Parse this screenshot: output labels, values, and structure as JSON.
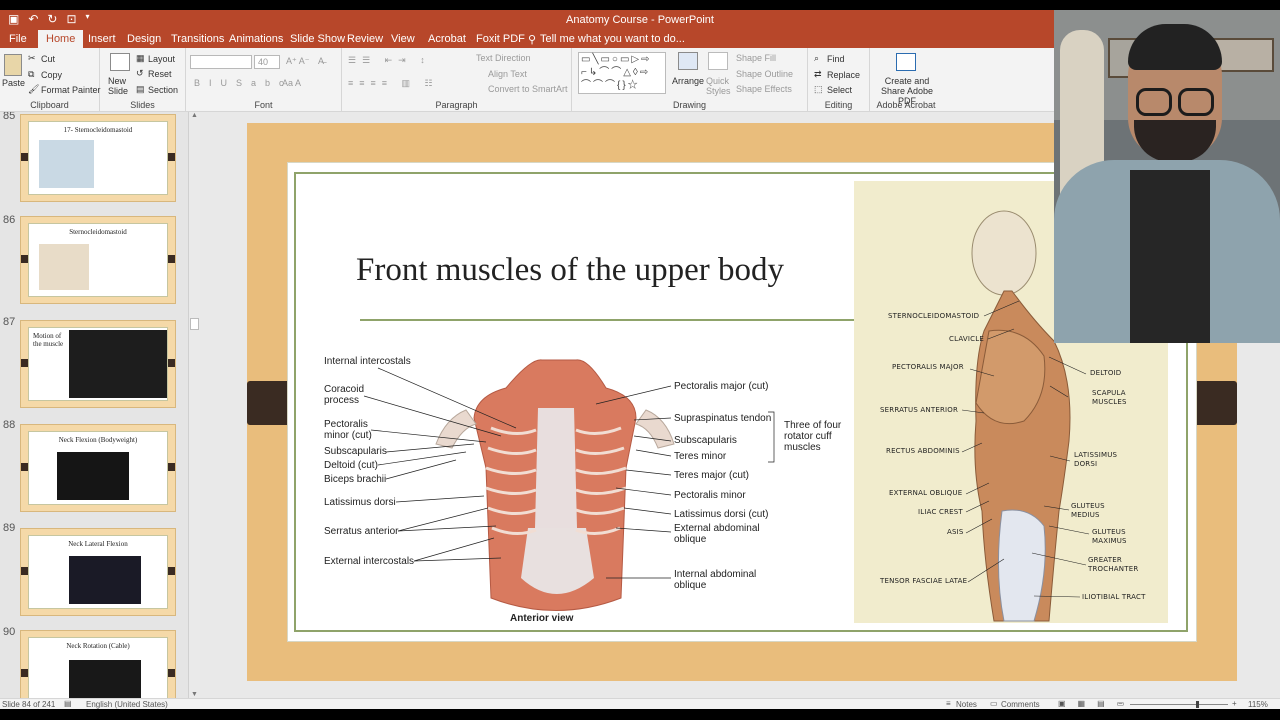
{
  "app": {
    "title": "Anatomy Course - PowerPoint"
  },
  "tabs": [
    "File",
    "Home",
    "Insert",
    "Design",
    "Transitions",
    "Animations",
    "Slide Show",
    "Review",
    "View",
    "Acrobat",
    "Foxit PDF"
  ],
  "tell_me": "Tell me what you want to do...",
  "ribbon": {
    "clipboard": {
      "label": "Clipboard",
      "paste": "Paste",
      "cut": "Cut",
      "copy": "Copy",
      "format_painter": "Format Painter"
    },
    "slides": {
      "label": "Slides",
      "new_slide": "New Slide",
      "layout": "Layout",
      "reset": "Reset",
      "section": "Section"
    },
    "font": {
      "label": "Font",
      "size": "40"
    },
    "paragraph": {
      "label": "Paragraph",
      "text_direction": "Text Direction",
      "align_text": "Align Text",
      "convert": "Convert to SmartArt"
    },
    "drawing": {
      "label": "Drawing",
      "arrange": "Arrange",
      "quick_styles": "Quick Styles",
      "shape_fill": "Shape Fill",
      "shape_outline": "Shape Outline",
      "shape_effects": "Shape Effects"
    },
    "editing": {
      "label": "Editing",
      "find": "Find",
      "replace": "Replace",
      "select": "Select"
    },
    "adobe": {
      "label": "Adobe Acrobat",
      "create_share": "Create and Share Adobe PDF"
    }
  },
  "thumbnails": [
    {
      "num": "85",
      "title": "17- Sternocleidomastoid"
    },
    {
      "num": "86",
      "title": "Sternocleidomastoid"
    },
    {
      "num": "87",
      "title": "Motion of the muscle"
    },
    {
      "num": "88",
      "title": "Neck Flexion (Bodyweight)"
    },
    {
      "num": "89",
      "title": "Neck Lateral Flexion"
    },
    {
      "num": "90",
      "title": "Neck Rotation (Cable)"
    }
  ],
  "slide": {
    "title": "Front muscles of the upper body",
    "left_labels": {
      "internal_intercostals": "Internal intercostals",
      "coracoid_process": "Coracoid process",
      "pectoralis_minor_cut": "Pectoralis minor (cut)",
      "subscapularis": "Subscapularis",
      "deltoid_cut": "Deltoid (cut)",
      "biceps_brachii": "Biceps brachii",
      "latissimus_dorsi": "Latissimus dorsi",
      "serratus_anterior": "Serratus anterior",
      "external_intercostals": "External intercostals"
    },
    "right_labels": {
      "pectoralis_major_cut": "Pectoralis major (cut)",
      "supraspinatus_tendon": "Supraspinatus tendon",
      "subscapularis": "Subscapularis",
      "teres_minor": "Teres minor",
      "teres_major_cut": "Teres major (cut)",
      "pectoralis_minor": "Pectoralis minor",
      "latissimus_dorsi_cut": "Latissimus dorsi (cut)",
      "external_abdominal_oblique": "External abdominal oblique",
      "internal_abdominal_oblique": "Internal abdominal oblique",
      "rotator_note": "Three of four rotator cuff muscles"
    },
    "view_caption": "Anterior view",
    "side_labels": {
      "sternocleidomastoid": "STERNOCLEIDOMASTOID",
      "clavicle": "CLAVICLE",
      "pectoralis_major": "PECTORALIS MAJOR",
      "serratus_anterior": "SERRATUS ANTERIOR",
      "rectus_abdominis": "RECTUS ABDOMINIS",
      "external_oblique": "EXTERNAL OBLIQUE",
      "iliac_crest": "ILIAC CREST",
      "asis": "ASIS",
      "tensor_fasciae_latae": "TENSOR FASCIAE LATAE",
      "deltoid": "DELTOID",
      "scapula_muscles": "SCAPULA MUSCLES",
      "latissimus_dorsi": "LATISSIMUS DORSI",
      "gluteus_medius": "GLUTEUS MEDIUS",
      "gluteus_maximus": "GLUTEUS MAXIMUS",
      "greater_trochanter": "GREATER TROCHANTER",
      "iliotibial_tract": "ILIOTIBIAL TRACT"
    }
  },
  "status": {
    "slide_info": "Slide 84 of 241",
    "language": "English (United States)",
    "notes": "Notes",
    "comments": "Comments",
    "zoom": "115%"
  },
  "colors": {
    "accent": "#b7472a",
    "slide_bg": "#e9bd7c",
    "frame": "#8fa36a"
  }
}
